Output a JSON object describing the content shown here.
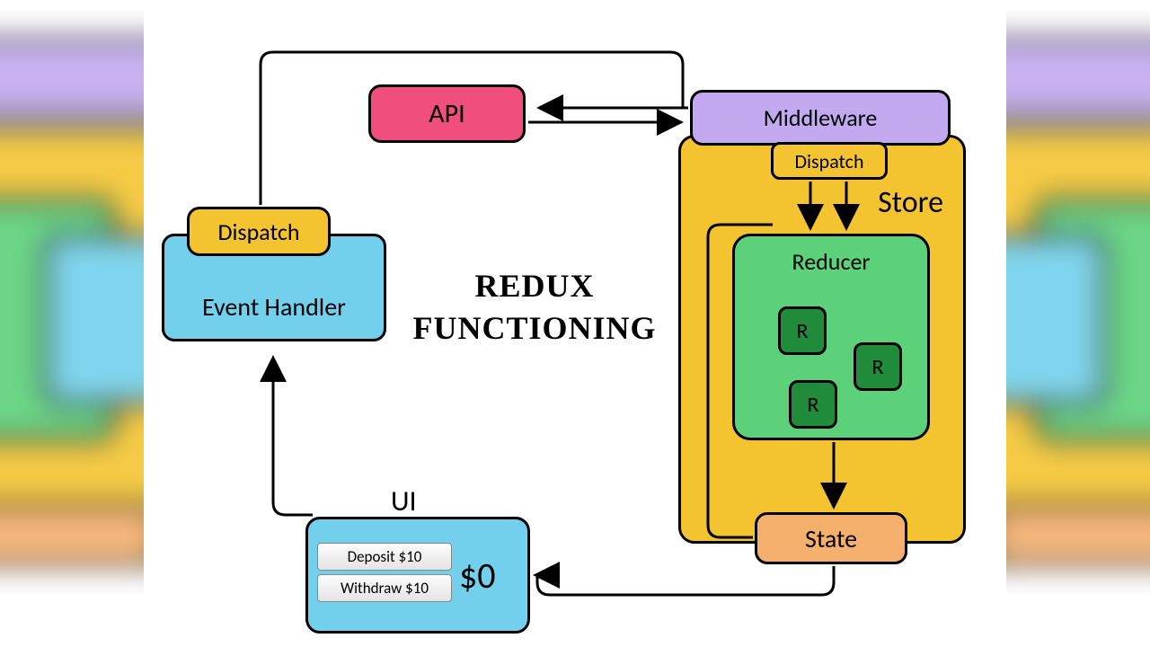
{
  "title_line1": "Redux",
  "title_line2": "Functioning",
  "boxes": {
    "event_handler": "Event Handler",
    "dispatch_left": "Dispatch",
    "api": "API",
    "middleware": "Middleware",
    "store": "Store",
    "dispatch_store": "Dispatch",
    "reducer": "Reducer",
    "r": "R",
    "state": "State",
    "ui": "UI"
  },
  "ui_panel": {
    "deposit": "Deposit $10",
    "withdraw": "Withdraw $10",
    "balance": "$0"
  },
  "colors": {
    "blue": "#73d0ec",
    "yellow": "#f4c430",
    "pink": "#f04f7e",
    "purple": "#c3a9ef",
    "green": "#5cd17a",
    "dark_green": "#1f8b3b",
    "orange": "#f5b06e"
  }
}
